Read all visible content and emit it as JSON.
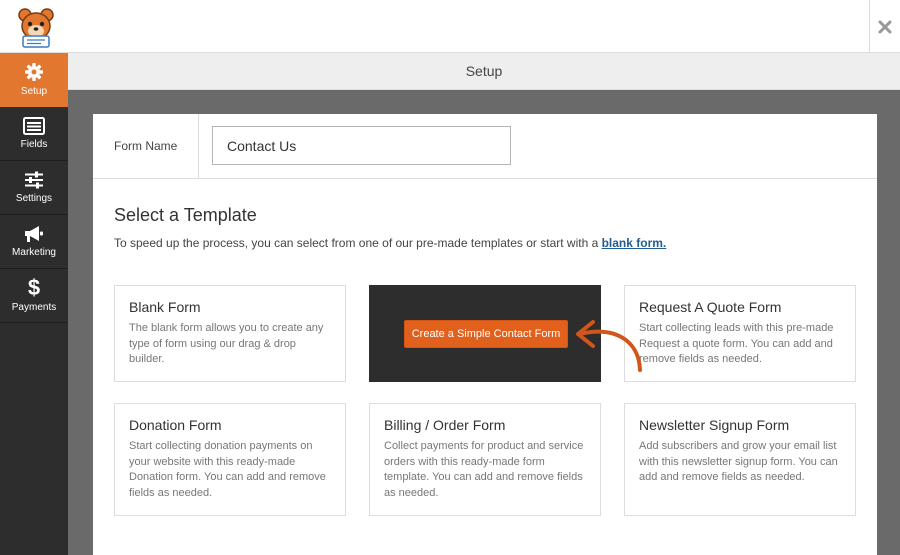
{
  "app": {
    "logo_icon": "bear-mascot-icon",
    "close_icon": "close-icon"
  },
  "sidebar": {
    "items": [
      {
        "label": "Setup",
        "icon": "gear-icon",
        "active": true
      },
      {
        "label": "Fields",
        "icon": "list-icon"
      },
      {
        "label": "Settings",
        "icon": "sliders-icon"
      },
      {
        "label": "Marketing",
        "icon": "megaphone-icon"
      },
      {
        "label": "Payments",
        "icon": "dollar-icon"
      }
    ]
  },
  "header": {
    "title": "Setup"
  },
  "form_name": {
    "label": "Form Name",
    "value": "Contact Us"
  },
  "templates": {
    "title": "Select a Template",
    "description": "To speed up the process, you can select from one of our pre-made templates or start with a",
    "blank_link": "blank form.",
    "hover_button": "Create a Simple Contact Form",
    "cards": [
      {
        "title": "Blank Form",
        "desc": "The blank form allows you to create any type of form using our drag & drop builder."
      },
      {
        "title": "Simple Contact Form",
        "desc": ""
      },
      {
        "title": "Request A Quote Form",
        "desc": "Start collecting leads with this pre-made Request a quote form. You can add and remove fields as needed."
      },
      {
        "title": "Donation Form",
        "desc": "Start collecting donation payments on your website with this ready-made Donation form. You can add and remove fields as needed."
      },
      {
        "title": "Billing / Order Form",
        "desc": "Collect payments for product and service orders with this ready-made form template. You can add and remove fields as needed."
      },
      {
        "title": "Newsletter Signup Form",
        "desc": "Add subscribers and grow your email list with this newsletter signup form. You can add and remove fields as needed."
      }
    ]
  },
  "colors": {
    "accent": "#e27730",
    "sidebar_bg": "#2d2d2d",
    "link": "#215d8f"
  }
}
